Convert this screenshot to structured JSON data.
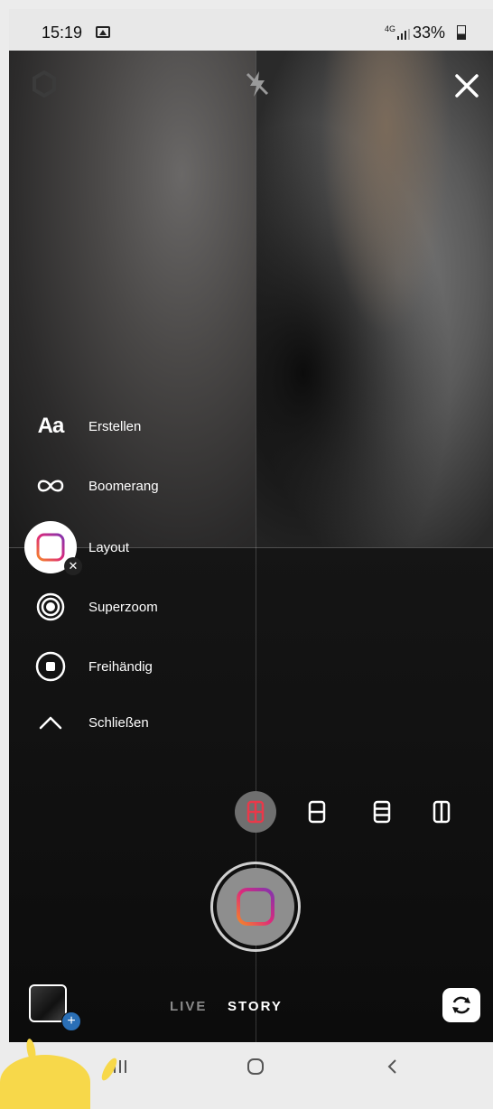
{
  "status_bar": {
    "time": "15:19",
    "network": "4G",
    "battery_text": "33%"
  },
  "top_controls": {
    "settings_icon": "settings-icon",
    "flash_icon": "flash-off-icon",
    "close_icon": "close-icon"
  },
  "menu": [
    {
      "key": "create",
      "label": "Erstellen",
      "icon": "text-aa-icon"
    },
    {
      "key": "boomerang",
      "label": "Boomerang",
      "icon": "infinity-icon"
    },
    {
      "key": "layout",
      "label": "Layout",
      "icon": "layout-icon",
      "active": true
    },
    {
      "key": "superzoom",
      "label": "Superzoom",
      "icon": "superzoom-icon"
    },
    {
      "key": "handsfree",
      "label": "Freihändig",
      "icon": "record-icon"
    },
    {
      "key": "close",
      "label": "Schließen",
      "icon": "chevron-up-icon"
    }
  ],
  "aa_glyph": "Aa",
  "layout_options": [
    {
      "key": "grid-4",
      "selected": true
    },
    {
      "key": "split-horizontal-2",
      "selected": false
    },
    {
      "key": "split-horizontal-3",
      "selected": false
    },
    {
      "key": "split-vertical-2",
      "selected": false
    }
  ],
  "modes": {
    "live": "LIVE",
    "story": "STORY",
    "selected": "STORY"
  },
  "colors": {
    "accent_gradient_start": "#f58529",
    "accent_gradient_mid": "#dd2a7b",
    "accent_gradient_end": "#8134af",
    "gallery_plus": "#2a6fb6"
  }
}
